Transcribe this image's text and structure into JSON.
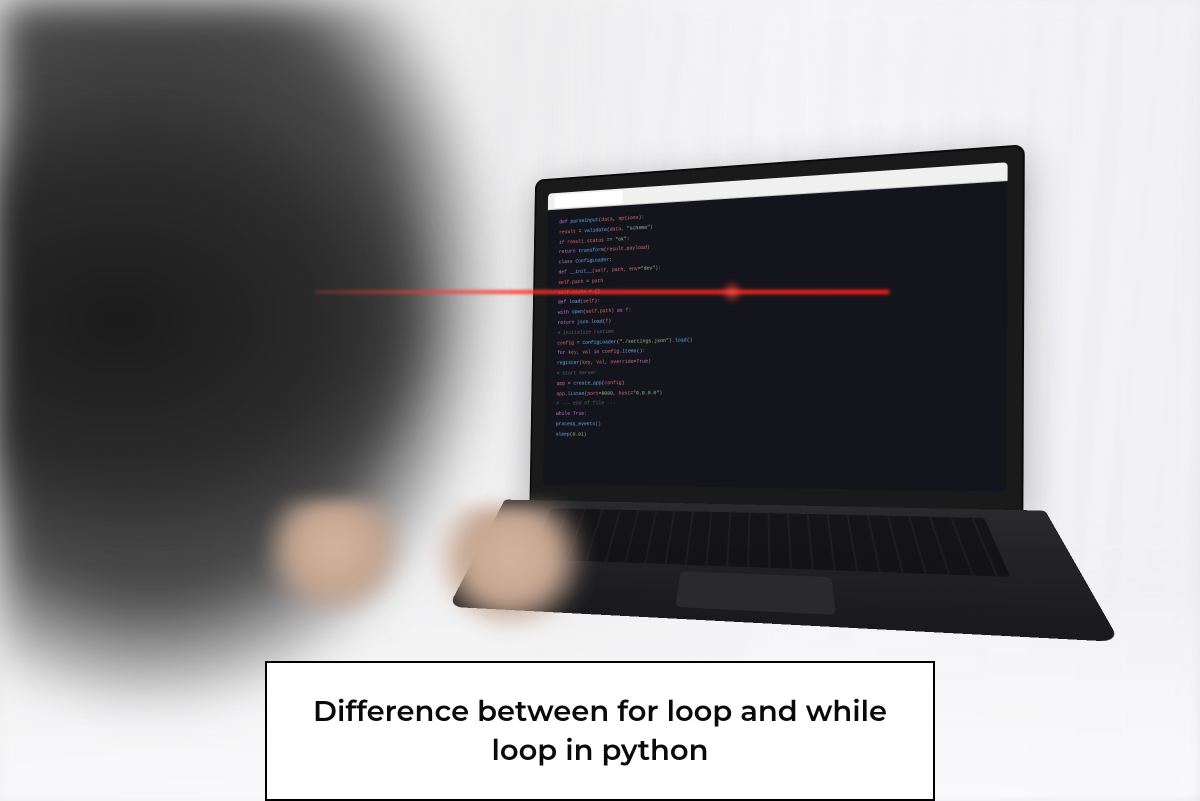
{
  "caption": {
    "title": "Difference between for loop and while loop in python"
  }
}
